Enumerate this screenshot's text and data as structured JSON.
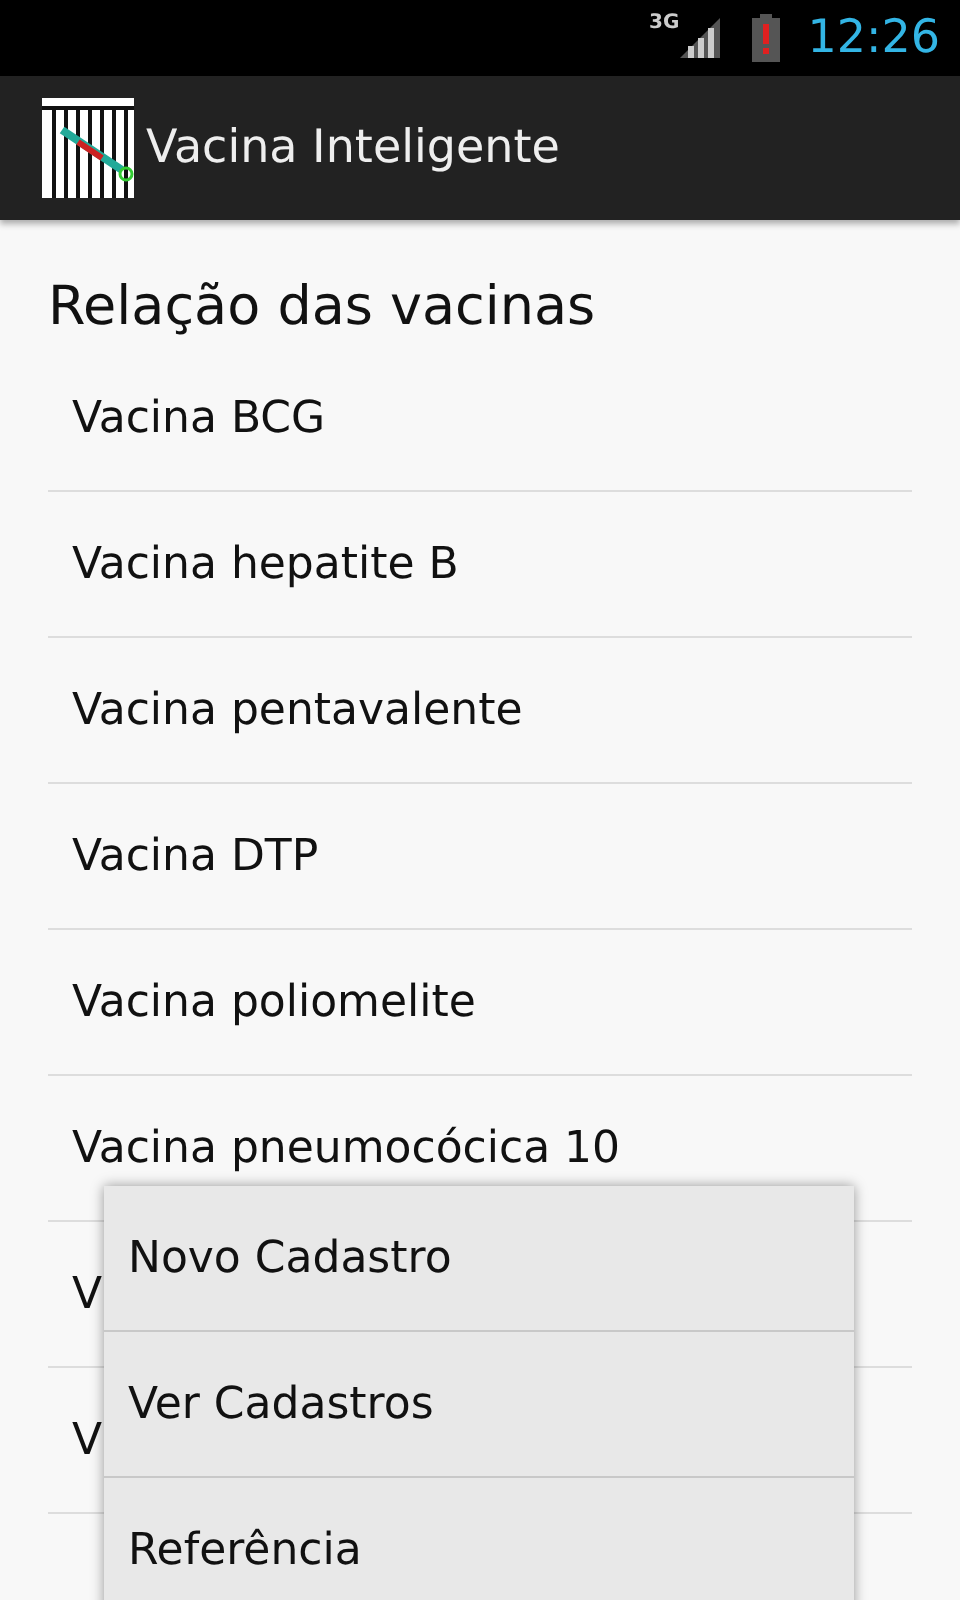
{
  "status_bar": {
    "network": "3G",
    "time": "12:26",
    "battery_alert": true
  },
  "action_bar": {
    "title": "Vacina Inteligente"
  },
  "list": {
    "heading": "Relação das vacinas",
    "items": [
      {
        "label": "Vacina BCG"
      },
      {
        "label": "Vacina hepatite B"
      },
      {
        "label": "Vacina pentavalente"
      },
      {
        "label": "Vacina DTP"
      },
      {
        "label": "Vacina poliomelite"
      },
      {
        "label": "Vacina pneumocócica 10"
      },
      {
        "label": "V"
      },
      {
        "label": "V"
      }
    ]
  },
  "menu": {
    "items": [
      {
        "label": "Novo Cadastro"
      },
      {
        "label": "Ver Cadastros"
      },
      {
        "label": "Referência"
      }
    ]
  }
}
